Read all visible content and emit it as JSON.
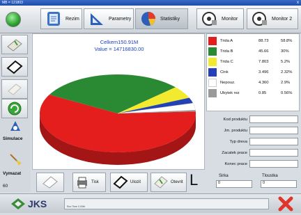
{
  "window": {
    "title": "MB = 121803",
    "close": "x"
  },
  "toolbar": {
    "rezim": "Rezim",
    "parametry": "Parametry",
    "statistiky": "Statistiky",
    "monitor": "Monitor",
    "monitor2": "Monitor 2"
  },
  "sidebar": {
    "simulace": "Simulace",
    "vymazat": "Vymazat",
    "count": "60"
  },
  "chart_data": {
    "type": "pie",
    "title": "Celkem150.91M",
    "subtitle": "Value = 14716830.00",
    "categories": [
      "Trida A",
      "Trida B",
      "Trida C",
      "Cink",
      "Nepouz.",
      "Ubytek rez"
    ],
    "values": [
      88.73,
      45.66,
      7.803,
      3.496,
      4.36,
      0.85
    ],
    "percents": [
      "58.8%",
      "30%",
      "5.2%",
      "2.32%",
      "2.9%",
      "0.56%"
    ],
    "colors": [
      "#e41d1d",
      "#2a8a34",
      "#f2ea2e",
      "#2340b4",
      "#ffffff",
      "#9a9a9a"
    ],
    "legend": "right"
  },
  "legend_rows": [
    {
      "name": "Trida A",
      "value": "88.73",
      "pct": "58.8%"
    },
    {
      "name": "Trida B",
      "value": "45.66",
      "pct": "30%"
    },
    {
      "name": "Trida C",
      "value": "7.803",
      "pct": "5.2%"
    },
    {
      "name": "Cink",
      "value": "3.496",
      "pct": "2.32%"
    },
    {
      "name": "Nepouz.",
      "value": "4.360",
      "pct": "2.9%"
    },
    {
      "name": "Ubytek rez",
      "value": "0.85",
      "pct": "0.56%"
    }
  ],
  "form": {
    "kod_produktu": "Kod produktu",
    "jm_produktu": "Jm. produktu",
    "typ_dreva": "Typ dreva",
    "zacatek_prace": "Zacatek prace",
    "konec_prace": "Konec prace"
  },
  "bottom": {
    "tisk": "Tisk",
    "ulozit": "Ulozit",
    "otevrit": "Otevrit",
    "l_mark": "L"
  },
  "dims": {
    "sirka_label": "Sirka",
    "sirka_value": "0",
    "tloustka_label": "Tloustka",
    "tloustka_value": "0"
  },
  "footer": {
    "logo": "JKS",
    "status": "Run Time 0.00Hr"
  }
}
